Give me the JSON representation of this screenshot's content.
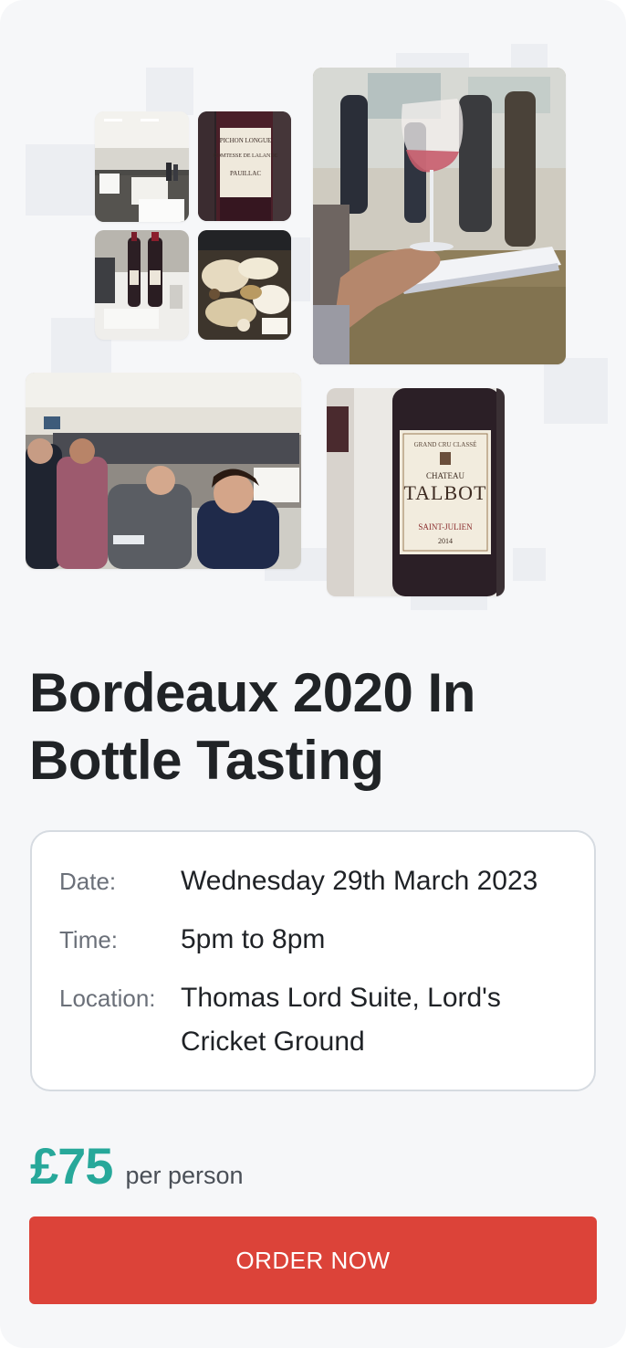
{
  "event": {
    "title": "Bordeaux 2020 In Bottle Tasting"
  },
  "gallery": {
    "images": [
      {
        "name": "tasting-room-photo",
        "alt": "Tasting room with tables"
      },
      {
        "name": "pichon-lalande-bottle-photo",
        "label_line1": "PICHON LONGUE",
        "label_line2": "COMTESSE DE LALANDE",
        "label_line3": "PAUILLAC"
      },
      {
        "name": "wine-bottles-table-photo",
        "alt": "Wine bottles on table"
      },
      {
        "name": "cheese-board-photo",
        "alt": "Cheese board"
      },
      {
        "name": "wine-glass-notes-photo",
        "alt": "Hand holding wine glass over tasting notes"
      },
      {
        "name": "crowded-tasting-hall-photo",
        "alt": "Crowded tasting hall"
      },
      {
        "name": "chateau-talbot-bottle-photo",
        "label_top": "GRAND CRU CLASSÉ",
        "label_chateau": "CHATEAU",
        "label_name": "TALBOT",
        "label_region": "SAINT-JULIEN",
        "label_year": "2014"
      }
    ]
  },
  "details": {
    "date_label": "Date:",
    "date_value": "Wednesday 29th March 2023",
    "time_label": "Time:",
    "time_value": "5pm to 8pm",
    "location_label": "Location:",
    "location_value": "Thomas Lord Suite, Lord's Cricket Ground"
  },
  "pricing": {
    "price": "£75",
    "unit": "per person"
  },
  "cta": {
    "label": "ORDER NOW"
  },
  "colors": {
    "accent": "#27a89a",
    "cta": "#dc4339"
  }
}
